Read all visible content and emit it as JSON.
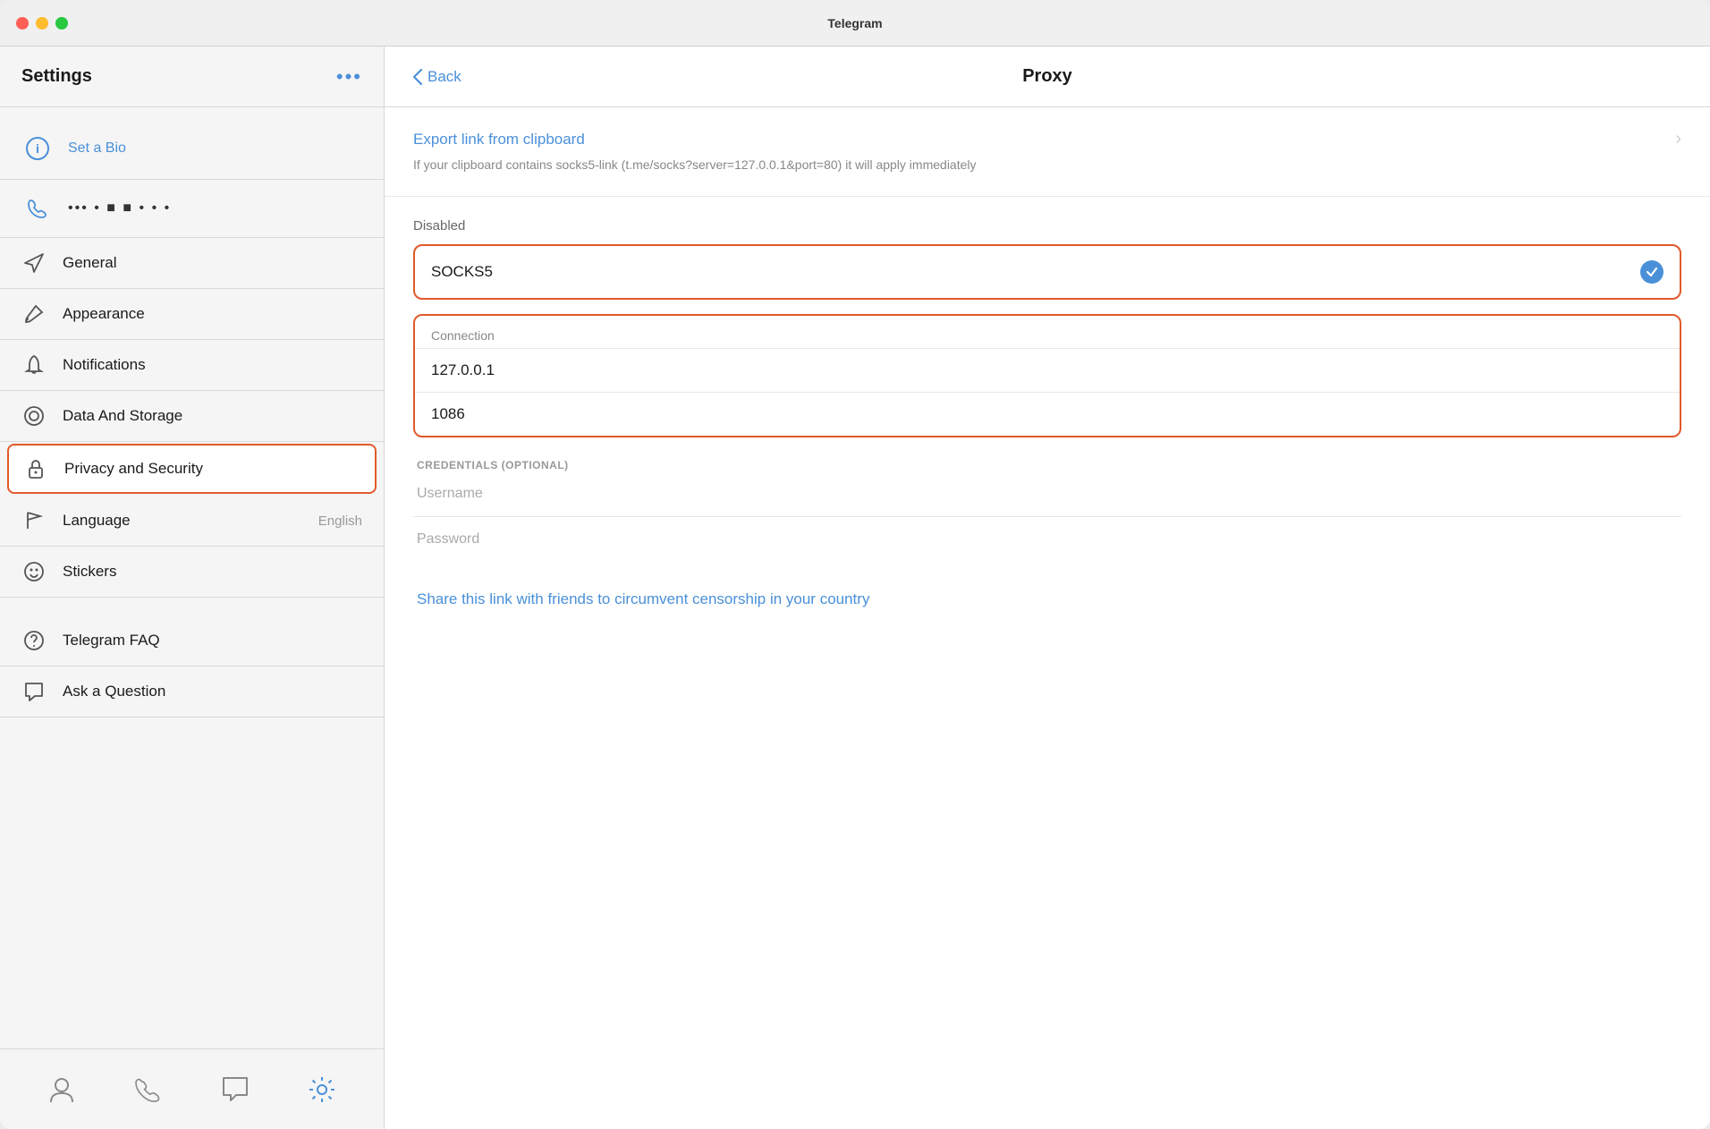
{
  "window": {
    "title": "Telegram"
  },
  "titlebar": {
    "title": "Telegram"
  },
  "sidebar": {
    "title": "Settings",
    "more_label": "•••",
    "profile": {
      "bio_label": "Set a Bio"
    },
    "phone": {
      "number": "•••   • ■ ■ •   • •"
    },
    "nav_items": [
      {
        "id": "general",
        "label": "General",
        "value": ""
      },
      {
        "id": "appearance",
        "label": "Appearance",
        "value": ""
      },
      {
        "id": "notifications",
        "label": "Notifications",
        "value": ""
      },
      {
        "id": "data-storage",
        "label": "Data And Storage",
        "value": ""
      },
      {
        "id": "privacy-security",
        "label": "Privacy and Security",
        "value": "",
        "active": true
      },
      {
        "id": "language",
        "label": "Language",
        "value": "English"
      },
      {
        "id": "stickers",
        "label": "Stickers",
        "value": ""
      }
    ],
    "secondary_items": [
      {
        "id": "faq",
        "label": "Telegram FAQ"
      },
      {
        "id": "ask",
        "label": "Ask a Question"
      }
    ],
    "footer_items": [
      {
        "id": "profile",
        "label": "Profile"
      },
      {
        "id": "calls",
        "label": "Calls"
      },
      {
        "id": "messages",
        "label": "Messages"
      },
      {
        "id": "settings",
        "label": "Settings",
        "active": true
      }
    ]
  },
  "proxy": {
    "back_label": "Back",
    "title": "Proxy",
    "export_label": "Export link from clipboard",
    "export_desc": "If your clipboard contains socks5-link (t.me/socks?server=127.0.0.1&port=80) it will apply immediately",
    "status_label": "Disabled",
    "socks5_label": "SOCKS5",
    "connection": {
      "header": "Connection",
      "ip": "127.0.0.1",
      "port": "1086"
    },
    "credentials": {
      "label": "CREDENTIALS (OPTIONAL)",
      "username_placeholder": "Username",
      "password_placeholder": "Password"
    },
    "share_link": "Share this link with friends to circumvent censorship in your country"
  }
}
